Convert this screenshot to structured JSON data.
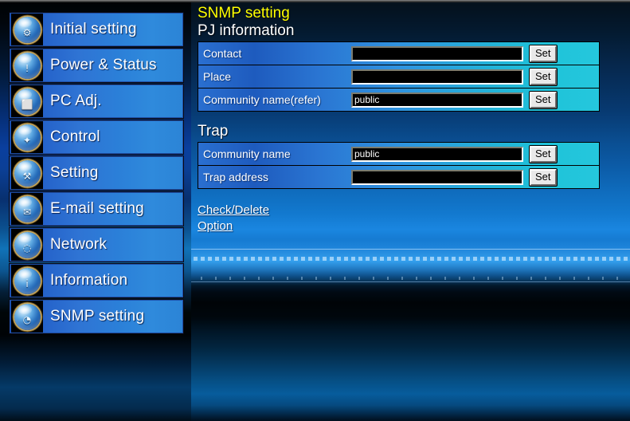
{
  "sidebar": {
    "items": [
      {
        "label": "Initial setting",
        "icon": "initial-setting-icon",
        "glyph": "⚙"
      },
      {
        "label": "Power & Status",
        "icon": "power-status-icon",
        "glyph": "!"
      },
      {
        "label": "PC Adj.",
        "icon": "pc-adjust-icon",
        "glyph": "⬜"
      },
      {
        "label": "Control",
        "icon": "control-icon",
        "glyph": "✦"
      },
      {
        "label": "Setting",
        "icon": "setting-icon",
        "glyph": "⚒"
      },
      {
        "label": "E-mail setting",
        "icon": "email-icon",
        "glyph": "✉"
      },
      {
        "label": "Network",
        "icon": "network-icon",
        "glyph": "◌"
      },
      {
        "label": "Information",
        "icon": "information-icon",
        "glyph": "i"
      },
      {
        "label": "SNMP setting",
        "icon": "snmp-setting-icon",
        "glyph": "◔"
      }
    ]
  },
  "main": {
    "page_title": "SNMP setting",
    "title_color": "#ffff00",
    "sections": [
      {
        "heading": "PJ information",
        "rows": [
          {
            "label": "Contact",
            "value": "",
            "button": "Set"
          },
          {
            "label": "Place",
            "value": "",
            "button": "Set"
          },
          {
            "label": "Community name(refer)",
            "value": "public",
            "button": "Set"
          }
        ]
      },
      {
        "heading": "Trap",
        "rows": [
          {
            "label": "Community name",
            "value": "public",
            "button": "Set"
          },
          {
            "label": "Trap address",
            "value": "",
            "button": "Set"
          }
        ]
      }
    ],
    "links": [
      {
        "label": "Check/Delete"
      },
      {
        "label": "Option"
      }
    ]
  }
}
